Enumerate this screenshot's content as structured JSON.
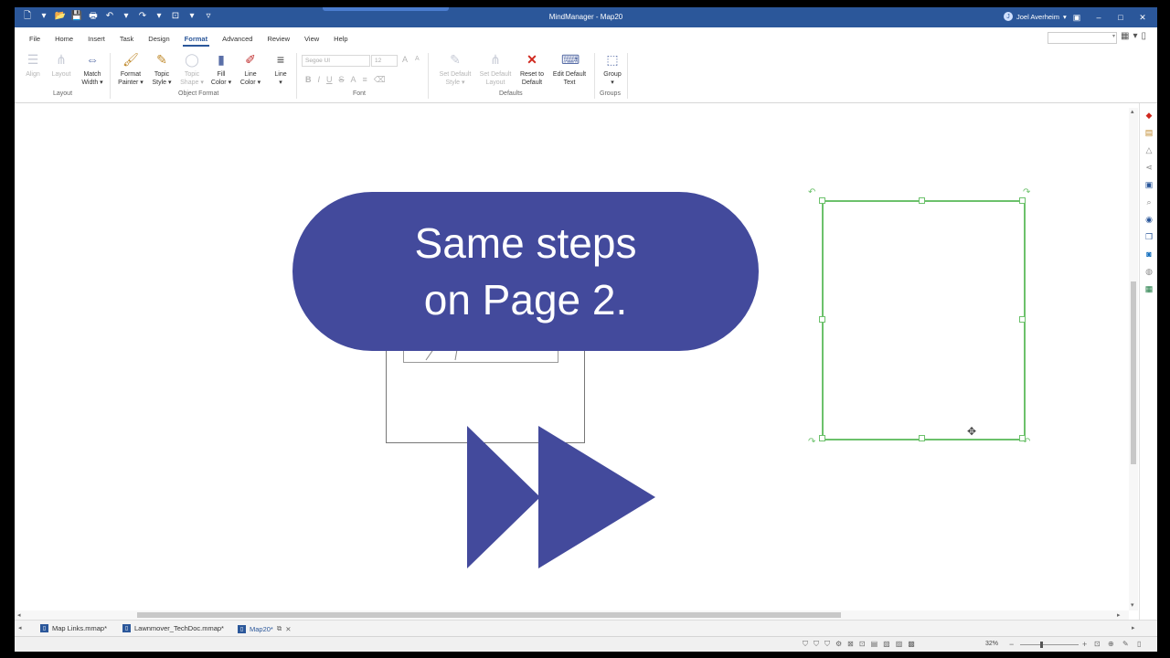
{
  "window": {
    "title": "MindManager - Map20",
    "user": "Joel Averheim",
    "user_initial": "J",
    "minimize": "–",
    "maximize": "□",
    "close": "✕",
    "display_options": "▣"
  },
  "qat": [
    "🗋",
    "▾",
    "📂",
    "💾",
    "🖶",
    "↶",
    "▾",
    "↷",
    "▾",
    "⊡",
    "▾",
    "▿"
  ],
  "menu": {
    "tabs": [
      "File",
      "Home",
      "Insert",
      "Task",
      "Design",
      "Format",
      "Advanced",
      "Review",
      "View",
      "Help"
    ],
    "active_tab": "Format",
    "search_placeholder": ""
  },
  "ribbon": {
    "align": "Align",
    "layout": "Layout",
    "match_width_1": "Match",
    "match_width_2": "Width ▾",
    "layout_group": "Layout",
    "format_painter_1": "Format",
    "format_painter_2": "Painter ▾",
    "topic_style_1": "Topic",
    "topic_style_2": "Style ▾",
    "topic_shape_1": "Topic",
    "topic_shape_2": "Shape ▾",
    "fill_color_1": "Fill",
    "fill_color_2": "Color ▾",
    "line_color_1": "Line",
    "line_color_2": "Color ▾",
    "line": "Line",
    "line_arrow": "▾",
    "object_format_group": "Object Format",
    "font_name": "Segoe UI",
    "font_size": "12",
    "font_group": "Font",
    "set_default_style_1": "Set Default",
    "set_default_style_2": "Style ▾",
    "set_default_layout_1": "Set Default",
    "set_default_layout_2": "Layout",
    "reset_default_1": "Reset to",
    "reset_default_2": "Default",
    "edit_default_text_1": "Edit Default",
    "edit_default_text_2": "Text",
    "defaults_group": "Defaults",
    "group": "Group",
    "group_arrow": "▾",
    "groups_group": "Groups"
  },
  "overlay": {
    "line1": "Same steps",
    "line2": "on Page 2."
  },
  "doc_tabs": [
    {
      "label": "Map Links.mmap*"
    },
    {
      "label": "Lawnmover_TechDoc.mmap*"
    },
    {
      "label": "Map20*"
    }
  ],
  "status": {
    "zoom": "32%"
  },
  "colors": {
    "titlebar": "#2b579a",
    "overlay": "#434a9c",
    "selection": "#6cc16b",
    "reset_icon": "#d0281e"
  }
}
